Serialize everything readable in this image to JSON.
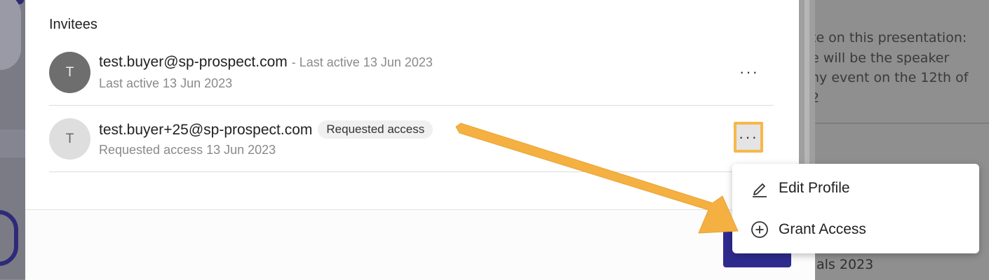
{
  "background": {
    "right_text_lines": [
      "te on this presentation:",
      "e will be the speaker",
      "ny event on the 12th of",
      "2"
    ],
    "right_bottom_text": "als 2023"
  },
  "modal": {
    "section_title": "Invitees",
    "invitees": [
      {
        "avatar_initial": "T",
        "email": "test.buyer@sp-prospect.com",
        "inline_meta": "- Last active 13 Jun 2023",
        "subline": "Last active 13 Jun 2023",
        "more_icon": "ellipsis-icon"
      },
      {
        "avatar_initial": "T",
        "email": "test.buyer+25@sp-prospect.com",
        "badge": "Requested access",
        "subline": "Requested access 13 Jun 2023",
        "more_icon": "ellipsis-icon"
      }
    ],
    "more_label": "···"
  },
  "menu": {
    "items": [
      {
        "label": "Edit Profile",
        "icon": "pencil-icon"
      },
      {
        "label": "Grant Access",
        "icon": "plus-circle-icon"
      }
    ]
  },
  "colors": {
    "highlight": "#f6b84a",
    "arrow": "#f5b042",
    "primary": "#2e2b8f"
  }
}
